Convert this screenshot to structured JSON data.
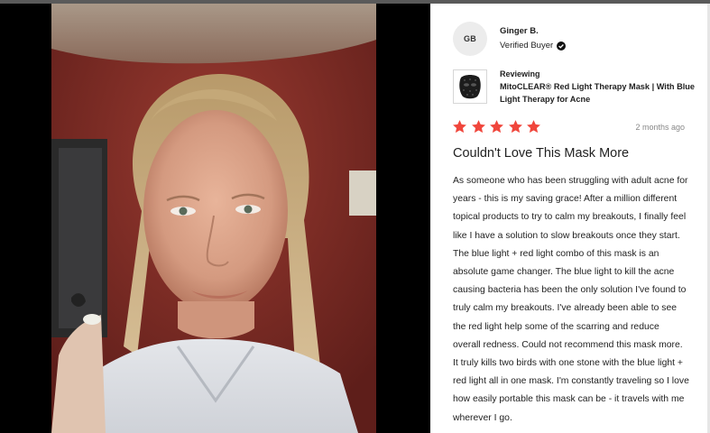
{
  "review": {
    "author_initials": "GB",
    "author_name": "Ginger B.",
    "verified_label": "Verified Buyer",
    "reviewing_label": "Reviewing",
    "product_name": "MitoCLEAR® Red Light Therapy Mask | With Blue Light Therapy for Acne",
    "rating": 5,
    "max_rating": 5,
    "date": "2 months ago",
    "title": "Couldn't Love This Mask More",
    "body": "As someone who has been struggling with adult acne for years - this is my saving grace! After a million different topical products to try to calm my breakouts, I finally feel like I have a solution to slow breakouts once they start. The blue light + red light combo of this mask is an absolute game changer. The blue light to kill the acne causing bacteria has been the only solution I've found to truly calm my breakouts. I've already been able to see the red light help some of the scarring and reduce overall redness. Could not recommend this mask more. It truly kills two birds with one stone with the blue light + red light all in one mask. I'm constantly traveling so I love how easily portable this mask can be - it travels with me wherever I go."
  },
  "colors": {
    "star": "#f0463c",
    "background": "#000000",
    "panel": "#ffffff",
    "wall": "#7a2a24"
  },
  "icons": {
    "verified": "check-circle-icon",
    "star": "star-icon",
    "product": "led-mask-thumbnail"
  }
}
